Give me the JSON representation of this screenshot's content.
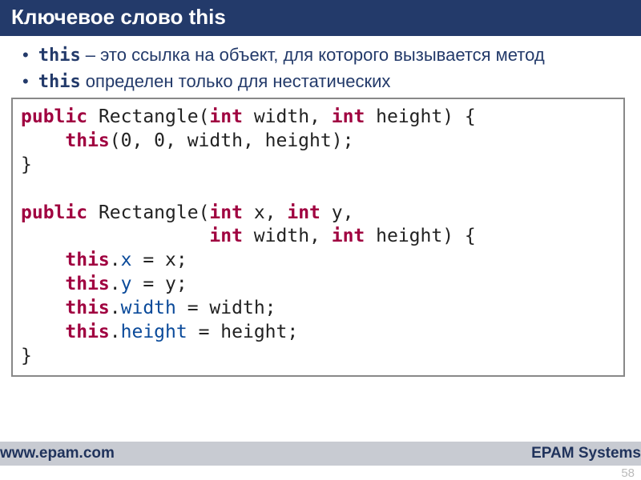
{
  "header": {
    "title": "Ключевое слово this"
  },
  "bullets": [
    {
      "prefix": "this",
      "rest": " – это ссылка на объект, для которого вызывается метод"
    },
    {
      "prefix": "this",
      "rest": " определен только для нестатических"
    }
  ],
  "code": {
    "line1_public": "public",
    "line1_mid": " Rectangle(",
    "line1_int1": "int",
    "line1_w": " width, ",
    "line1_int2": "int",
    "line1_h": " height) {",
    "line2_sp": "    ",
    "line2_this": "this",
    "line2_rest": "(0, 0, width, height);",
    "line3": "}",
    "blank": "",
    "line5_public": "public",
    "line5_mid": " Rectangle(",
    "line5_int1": "int",
    "line5_x": " x, ",
    "line5_int2": "int",
    "line5_y": " y,",
    "line6_sp": "                 ",
    "line6_int1": "int",
    "line6_w": " width, ",
    "line6_int2": "int",
    "line6_h": " height) {",
    "line7_sp": "    ",
    "line7_this": "this",
    "line7_dot": ".",
    "line7_field": "x",
    "line7_rest": " = x;",
    "line8_sp": "    ",
    "line8_this": "this",
    "line8_dot": ".",
    "line8_field": "y",
    "line8_rest": " = y;",
    "line9_sp": "    ",
    "line9_this": "this",
    "line9_dot": ".",
    "line9_field": "width",
    "line9_rest": " = width;",
    "line10_sp": "    ",
    "line10_this": "this",
    "line10_dot": ".",
    "line10_field": "height",
    "line10_rest": " = height;",
    "line11": "}"
  },
  "footer": {
    "left": "www.epam.com",
    "right": "EPAM Systems"
  },
  "page_number": "58"
}
